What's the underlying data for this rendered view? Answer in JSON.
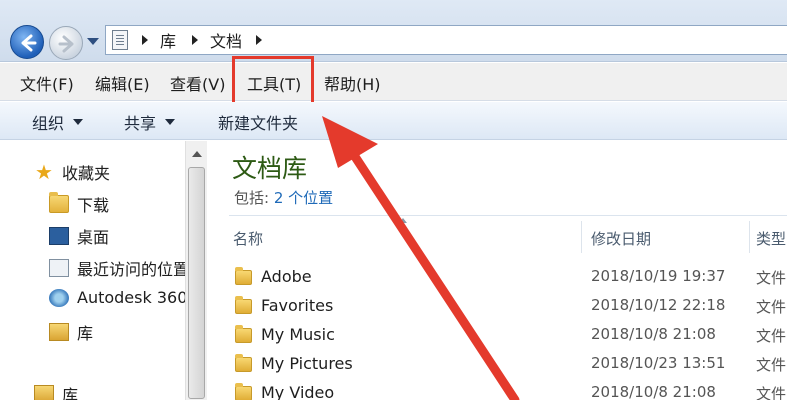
{
  "address_bar": {
    "breadcrumbs": [
      "库",
      "文档"
    ],
    "icons": [
      "back-arrow-icon",
      "forward-arrow-icon",
      "document-icon"
    ]
  },
  "menu": {
    "file": "文件(F)",
    "edit": "编辑(E)",
    "view": "查看(V)",
    "tools": "工具(T)",
    "help": "帮助(H)"
  },
  "toolbar": {
    "organize": "组织",
    "share": "共享",
    "new_folder": "新建文件夹"
  },
  "nav_pane": {
    "favorites": "收藏夹",
    "downloads": "下载",
    "desktop": "桌面",
    "recent": "最近访问的位置",
    "autodesk": "Autodesk 360",
    "library_sub": "库",
    "library": "库"
  },
  "library": {
    "title": "文档库",
    "includes_label": "包括: ",
    "includes_link": "2 个位置"
  },
  "columns": {
    "name": "名称",
    "date": "修改日期",
    "type": "类型"
  },
  "files": [
    {
      "name": "Adobe",
      "date": "2018/10/19 19:37",
      "type": "文件"
    },
    {
      "name": "Favorites",
      "date": "2018/10/12 22:18",
      "type": "文件"
    },
    {
      "name": "My Music",
      "date": "2018/10/8 21:08",
      "type": "文件"
    },
    {
      "name": "My Pictures",
      "date": "2018/10/23 13:51",
      "type": "文件"
    },
    {
      "name": "My Video",
      "date": "2018/10/8 21:08",
      "type": "文件"
    }
  ],
  "colors": {
    "highlight": "#e43a2c",
    "library_title": "#2d5a14",
    "link": "#1f6ab8"
  }
}
